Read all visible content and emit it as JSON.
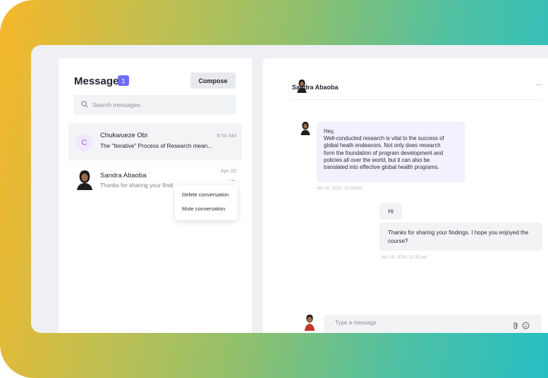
{
  "inbox": {
    "title": "Messages",
    "unread_count": "1",
    "compose_label": "Compose",
    "search_placeholder": "Search messages"
  },
  "conversations": [
    {
      "avatar_initial": "C",
      "name": "Chukwueze Obi",
      "time": "9:50 AM",
      "preview": "The \"Iterative\" Process of Research mean..."
    },
    {
      "name": "Sandra Abaoba",
      "time": "Apr 20",
      "preview": "Thanks for sharing your findi"
    }
  ],
  "context_menu": {
    "delete_label": "Delete conversation",
    "mute_label": "Mute conversation"
  },
  "chat": {
    "contact_name": "Sandra Abaoba",
    "more_label": "···",
    "incoming": {
      "lines": [
        "Hey,",
        "Well-conducted research is vital to the success of",
        "global heath endeavors. Not only does research",
        "form the foundation of program development and",
        "policies all over the world, but it can also be",
        "translated into effective global health programs."
      ],
      "timestamp": "Apr 20, 2020, 12:24 pm"
    },
    "outgoing": {
      "short_text": "Hi",
      "long_lines": [
        "Thanks for sharing your findings. I hope you enjoyed the",
        "course?"
      ],
      "timestamp": "Apr 20, 2020, 12:50 pm"
    },
    "composer_placeholder": "Type a message"
  },
  "icons": {
    "search": "search-icon",
    "more": "more-horizontal-icon",
    "attach": "paperclip-icon",
    "emoji": "smiley-icon"
  },
  "colors": {
    "accent": "#6d6cf6",
    "gradient_start": "#f6b72a",
    "gradient_end": "#27bfc4",
    "incoming_bubble": "#f2f1fe",
    "avatar_initial": "#b24ae7"
  }
}
